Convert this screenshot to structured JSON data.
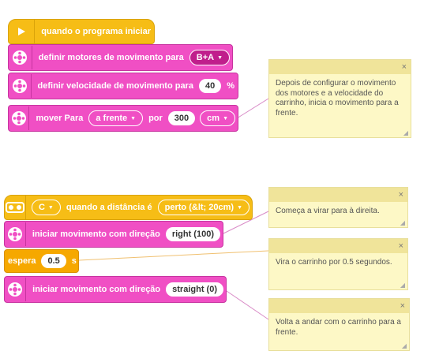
{
  "colors": {
    "event": "#f6bd16",
    "motor": "#f04fc4",
    "wait": "#f6a800",
    "note": "#fdf8c6"
  },
  "program1": {
    "hat_label": "quando o programa iniciar",
    "set_motors_label": "definir motores de movimento para",
    "set_motors_value": "B+A",
    "set_speed_label": "definir velocidade de movimento para",
    "set_speed_value": "40",
    "set_speed_unit": "%",
    "move_label": "mover Para",
    "move_direction": "a frente",
    "move_by_label": "por",
    "move_amount": "300",
    "move_unit": "cm"
  },
  "program2": {
    "sensor_port": "C",
    "hat_label": "quando a distância é",
    "hat_value": "perto (&lt; 20cm)",
    "start_label_1": "iniciar movimento com direção",
    "start_value_1": "right (100)",
    "wait_label": "espera",
    "wait_value": "0.5",
    "wait_unit": "s",
    "start_label_2": "iniciar movimento com direção",
    "start_value_2": "straight (0)"
  },
  "notes": [
    {
      "text": "Depois de configurar o movimento dos motores e a velocidade do carrinho, inicia o movimento para a frente.",
      "close": "×"
    },
    {
      "text": "Começa a virar para à direita.",
      "close": "×"
    },
    {
      "text": "Vira o carrinho por 0.5 segundos.",
      "close": "×"
    },
    {
      "text": "Volta a andar com o carrinho para a frente.",
      "close": "×"
    }
  ],
  "icons": {
    "play": "play-icon",
    "motor": "motor-icon",
    "distance": "distance-sensor-icon",
    "close": "close-icon",
    "resize": "resize-grip-icon"
  }
}
